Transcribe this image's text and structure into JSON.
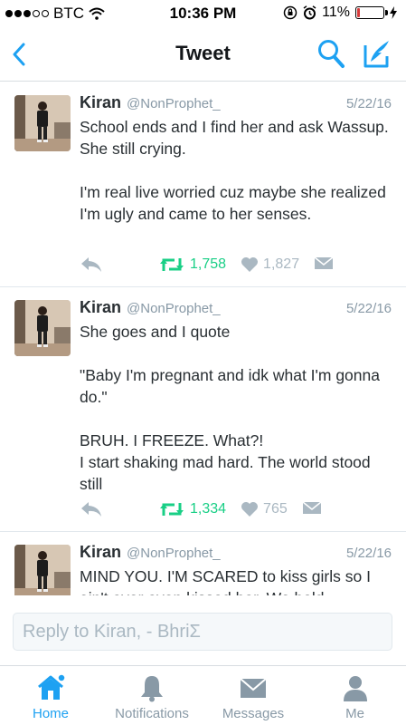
{
  "status_bar": {
    "carrier": "BTC",
    "time": "10:36 PM",
    "battery_percent": "11%",
    "battery_level": 0.11,
    "signal_bars": 3
  },
  "nav": {
    "title": "Tweet",
    "icons": [
      "back-icon",
      "search-icon",
      "compose-icon"
    ]
  },
  "tweets": [
    {
      "author": "Kiran",
      "handle": "@NonProphet_",
      "date": "5/22/16",
      "text": "School ends and I find her and ask Wassup. She still crying.\n\nI'm real live worried cuz maybe she realized I'm ugly and came to her senses.",
      "retweets": "1,758",
      "likes": "1,827"
    },
    {
      "author": "Kiran",
      "handle": "@NonProphet_",
      "date": "5/22/16",
      "text": "She goes and I quote\n\n\"Baby I'm pregnant and idk what I'm gonna do.\"\n\nBRUH. I FREEZE. What?!\nI start shaking mad hard. The world stood still",
      "retweets": "1,334",
      "likes": "765"
    },
    {
      "author": "Kiran",
      "handle": "@NonProphet_",
      "date": "5/22/16",
      "text": "MIND YOU. I'M SCARED to kiss girls so I ain't ever even kissed her. We held",
      "retweets": "",
      "likes": ""
    }
  ],
  "reply": {
    "placeholder": "Reply to Kiran, - BhriΣ"
  },
  "tabs": [
    {
      "label": "Home",
      "icon": "home-icon",
      "active": true
    },
    {
      "label": "Notifications",
      "icon": "bell-icon",
      "active": false
    },
    {
      "label": "Messages",
      "icon": "envelope-icon",
      "active": false
    },
    {
      "label": "Me",
      "icon": "person-icon",
      "active": false
    }
  ],
  "colors": {
    "accent": "#1da1f2",
    "retweet": "#19cf86",
    "muted": "#8899a6",
    "battery_low": "#d63b3b"
  }
}
